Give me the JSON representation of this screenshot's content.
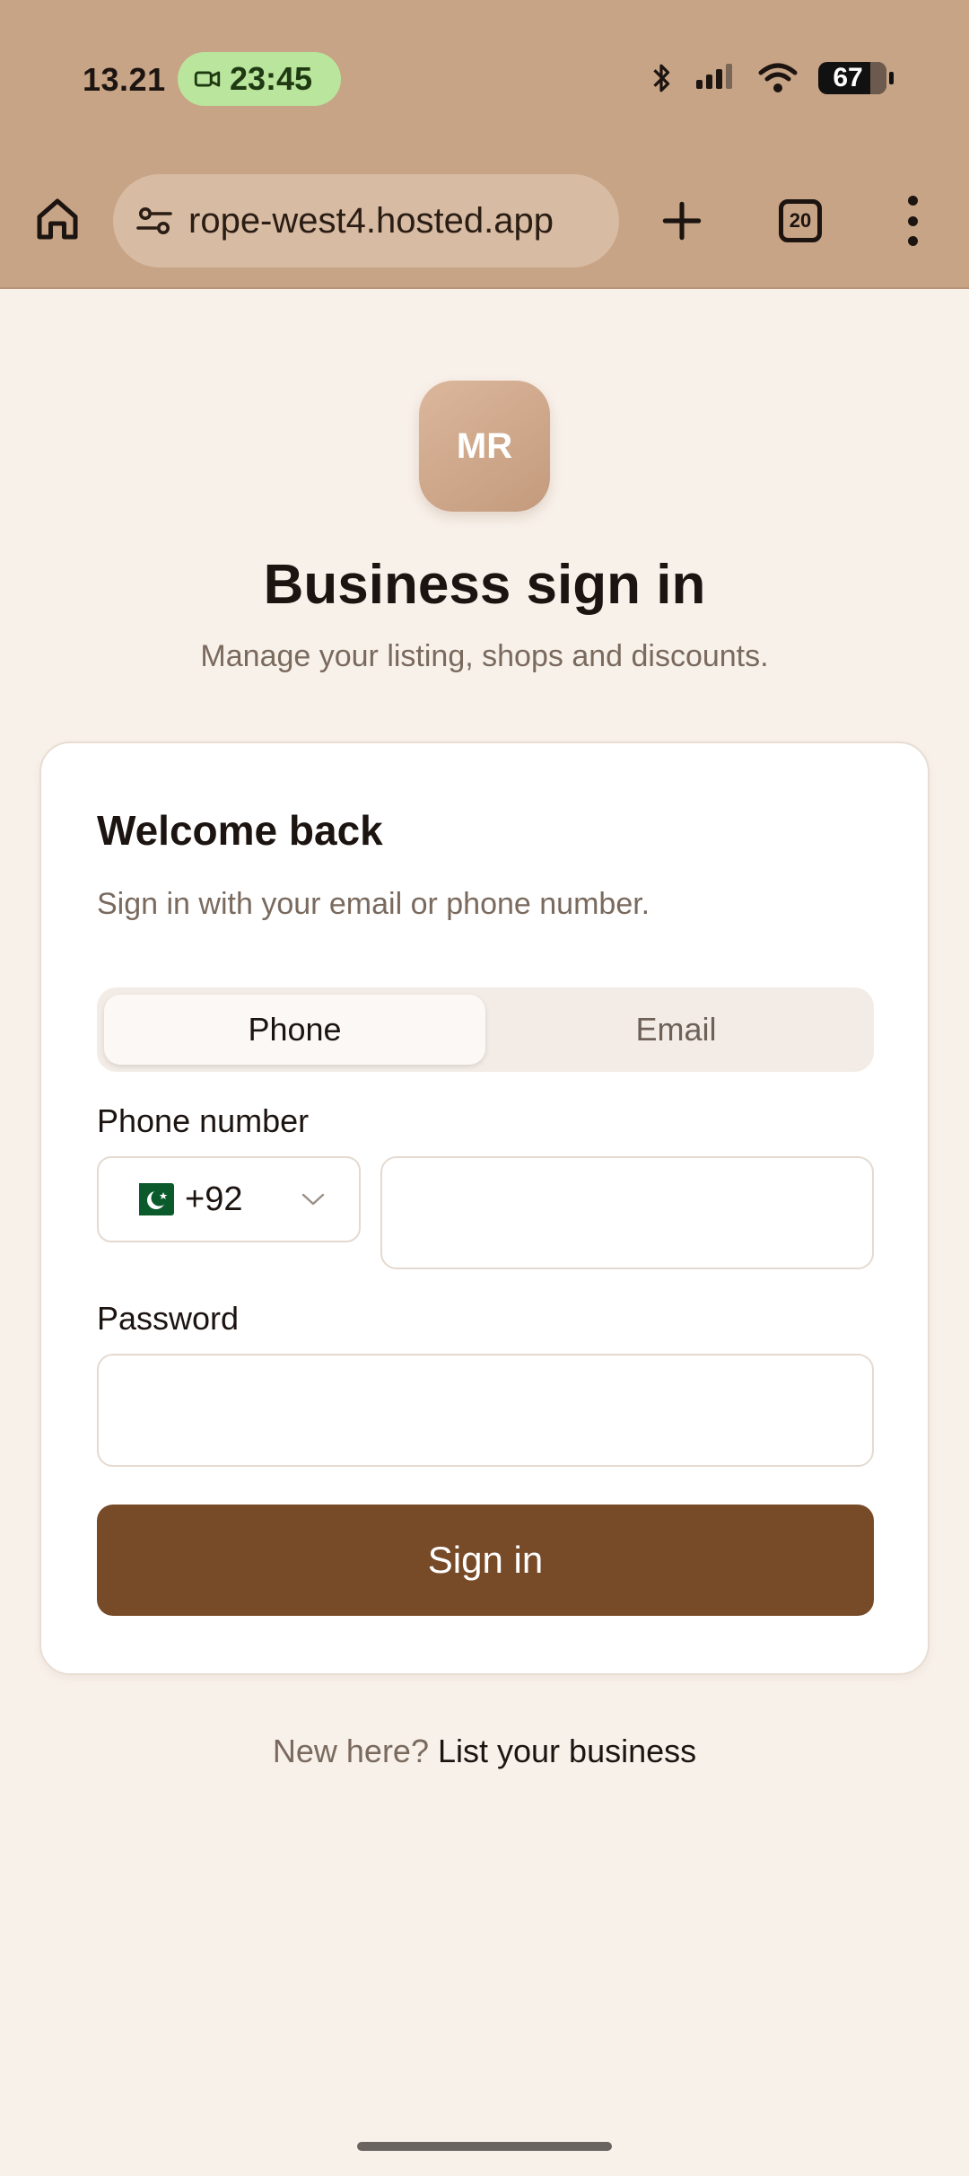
{
  "status_bar": {
    "time": "13.21",
    "call_timer": "23:45",
    "battery": "67"
  },
  "browser": {
    "url": "rope-west4.hosted.app",
    "tab_count": "20"
  },
  "brand": {
    "logo_text": "MR"
  },
  "header": {
    "title": "Business sign in",
    "subtitle": "Manage your listing, shops and discounts."
  },
  "card": {
    "title": "Welcome back",
    "subtitle": "Sign in with your email or phone number.",
    "tabs": [
      {
        "label": "Phone",
        "active": true
      },
      {
        "label": "Email",
        "active": false
      }
    ],
    "phone_label": "Phone number",
    "country_code": "+92",
    "password_label": "Password",
    "submit_label": "Sign in"
  },
  "footer": {
    "question": "New here?",
    "link": "List your business"
  },
  "colors": {
    "topbar": "#c8a486",
    "accent": "#774a28",
    "logo": "#c9a284",
    "page_bg": "#f8f1ea"
  }
}
